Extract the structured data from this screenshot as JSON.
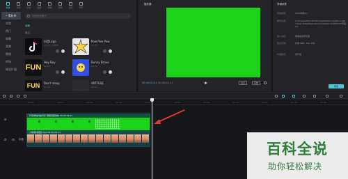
{
  "tabs": [
    {
      "label": "媒体",
      "active": true
    },
    {
      "label": "音频"
    },
    {
      "label": "文本"
    },
    {
      "label": "贴纸"
    },
    {
      "label": "特效"
    },
    {
      "label": "转场"
    },
    {
      "label": "滤镜"
    },
    {
      "label": "调节"
    }
  ],
  "sidebar": {
    "items": [
      {
        "label": "• 素材库",
        "active": true
      },
      {
        "label": "本地"
      },
      {
        "label": "热门"
      },
      {
        "label": "绿幕"
      },
      {
        "label": "背景"
      },
      {
        "label": "情绪"
      },
      {
        "label": "转场"
      },
      {
        "label": "搞笑片段"
      }
    ]
  },
  "search": {
    "placeholder": "搜索视频素材"
  },
  "library": {
    "section_collect": "收藏",
    "section_recent": "最近",
    "cards": [
      {
        "title": "抖音Logo",
        "sub": "00:03 | 1080P"
      },
      {
        "title": "Pow Pow Pow",
        "sub": "00:02"
      },
      {
        "title": "Hey Boy",
        "sub": "00:02"
      },
      {
        "title": "Bunny Bravo",
        "sub": "00:03"
      },
      {
        "title": "Don't sleep",
        "sub": "00:04"
      },
      {
        "title": "ARTFUSE",
        "sub": "00:03"
      }
    ],
    "fun_label": "FUN"
  },
  "player": {
    "title": "播放器",
    "time_current": "00:00:02:21",
    "time_total": "00:00:02:21",
    "fit_btn": "适应",
    "ratio_btn": "原始"
  },
  "inspector": {
    "title": "草稿参数",
    "rows": [
      {
        "k": "草稿名称：",
        "v": "0520草稿(1)"
      },
      {
        "k": "保存位置：",
        "v": "C:/Users/Administrator/AppData/Local/JianyingPro/User Data/Projects/com.lveditor.draft/0520草稿(1)"
      },
      {
        "k": "导入方式：",
        "v": "保留在原有位置"
      },
      {
        "k": "色彩空间：",
        "v": "标准 SDR - Rec.709"
      },
      {
        "k": "代理模式：",
        "v": "未开启"
      }
    ],
    "export_label": "修改"
  },
  "timeline": {
    "ticks": [
      "00:00",
      "00:10",
      "00:20",
      "00:30",
      "00:40",
      "00:50",
      "01:00",
      "01:10",
      "01:20",
      "01:30",
      "01:40"
    ],
    "green_clip_label": "抖音绿色科技背景 绿幕视频素材   00:00:02:21",
    "video_clip_label": "人物素材视频.mp4   00:00:09:23",
    "cover_label": "封面"
  },
  "watermark": {
    "main": "百科全说",
    "sub": "助你轻松解决"
  },
  "colors": {
    "accent": "#4ac7d8",
    "green_screen": "#1bd419",
    "clip_teal": "#176b72",
    "arrow": "#e53935"
  }
}
